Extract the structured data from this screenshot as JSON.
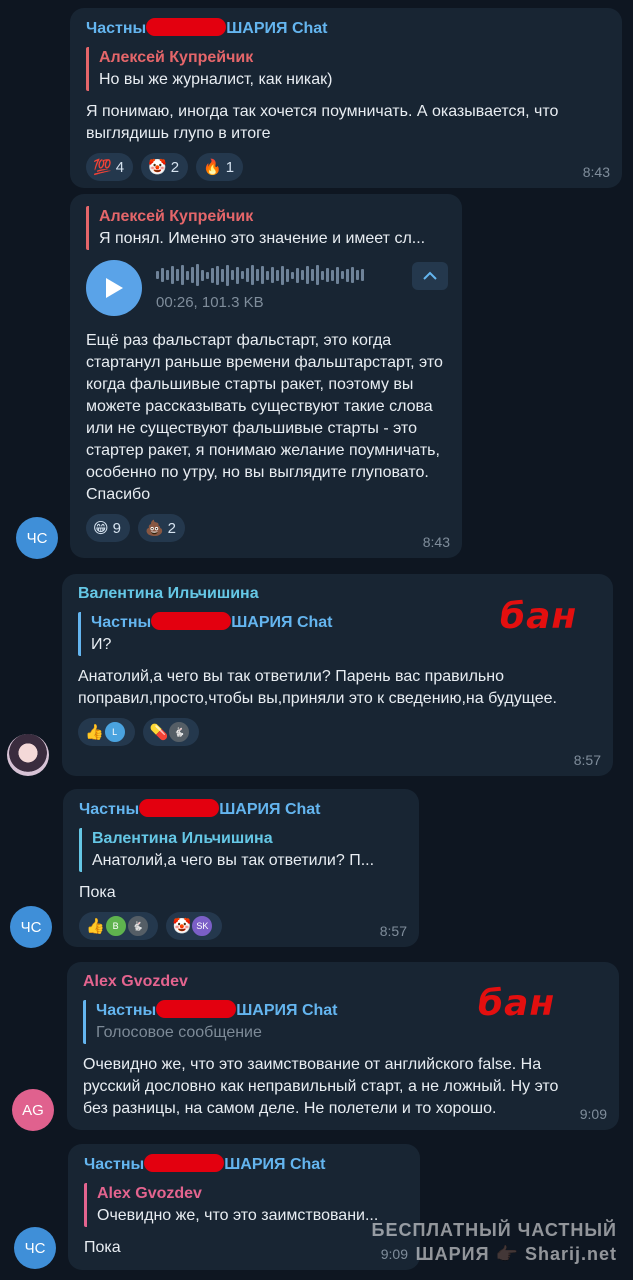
{
  "messages": [
    {
      "sender_prefix": "Частны",
      "sender_suffix": "ШАРИЯ Chat",
      "reply_name": "Алексей Купрейчик",
      "reply_text": "Но вы же журналист, как никак)",
      "text": "Я понимаю, иногда так хочется поумничать. А оказывается, что выглядишь глупо в итоге",
      "reactions": [
        {
          "emoji": "💯",
          "count": "4"
        },
        {
          "emoji": "🤡",
          "count": "2"
        },
        {
          "emoji": "🔥",
          "count": "1"
        }
      ],
      "time": "8:43"
    },
    {
      "reply_name": "Алексей Купрейчик",
      "reply_text": "Я понял. Именно это значение и имеет сл...",
      "voice_meta": "00:26, 101.3 KB",
      "text": "Ещё раз фальстарт фальстарт, это когда стартанул раньше времени фальштарстарт, это когда фальшивые старты ракет, поэтому вы можете рассказывать существуют такие слова или не существуют фальшивые старты - это стартер ракет, я понимаю желание поумничать, особенно по утру, но вы выглядите глуповато. Спасибо",
      "reactions": [
        {
          "emoji": "😁",
          "count": "9"
        },
        {
          "emoji": "💩",
          "count": "2"
        }
      ],
      "time": "8:43",
      "avatar": "ЧС"
    },
    {
      "sender": "Валентина Ильчишина",
      "reply_prefix": "Частны",
      "reply_suffix": "ШАРИЯ Chat",
      "reply_text": "И?",
      "text": "Анатолий,а чего вы так ответили? Парень вас правильно поправил,просто,чтобы вы,приняли это к сведению,на будущее.",
      "reactions": [
        {
          "emoji": "👍",
          "mini": "L",
          "mini_color": "#4aa3df"
        },
        {
          "emoji": "💊",
          "mini": "🐇",
          "mini_color": "#555e66"
        }
      ],
      "time": "8:57",
      "ban": "бан"
    },
    {
      "sender_prefix": "Частны",
      "sender_suffix": "ШАРИЯ Chat",
      "reply_name": "Валентина Ильчишина",
      "reply_text": "Анатолий,а чего вы так ответили? П...",
      "text": "Пока",
      "reactions": [
        {
          "emoji": "👍",
          "mini": "B",
          "mini_color": "#5fb34e",
          "mini2": "🐇",
          "mini2_color": "#555e66"
        },
        {
          "emoji": "🤡",
          "mini": "SK",
          "mini_color": "#7b5fc7"
        }
      ],
      "time": "8:57",
      "avatar": "ЧС"
    },
    {
      "sender": "Alex Gvozdev",
      "reply_prefix": "Частны",
      "reply_suffix": "ШАРИЯ Chat",
      "reply_text": "Голосовое сообщение",
      "text": "Очевидно же, что это заимствование от английского false. На русский дословно как неправильный старт, а не ложный. Ну это без разницы, на самом деле. Не полетели и то хорошо.",
      "time": "9:09",
      "avatar": "AG",
      "ban": "бан"
    },
    {
      "sender_prefix": "Частны",
      "sender_suffix": "ШАРИЯ Chat",
      "reply_name": "Alex Gvozdev",
      "reply_text": "Очевидно же, что это заимствовани...",
      "text": "Пока",
      "time": "9:09",
      "avatar": "ЧС"
    }
  ],
  "watermark": {
    "line1": "БЕСПЛАТНЫЙ ЧАСТНЫЙ",
    "line2": "ШАРИЯ 👉🏿 Sharij.net"
  },
  "colors": {
    "background": "#0e1621",
    "bubble": "#182533",
    "sender_blue": "#64b5ef",
    "reply_red": "#e5666a",
    "alex_pink": "#e4648f",
    "valentina_cyan": "#65c7e5",
    "ban_red": "#e30f0f"
  }
}
